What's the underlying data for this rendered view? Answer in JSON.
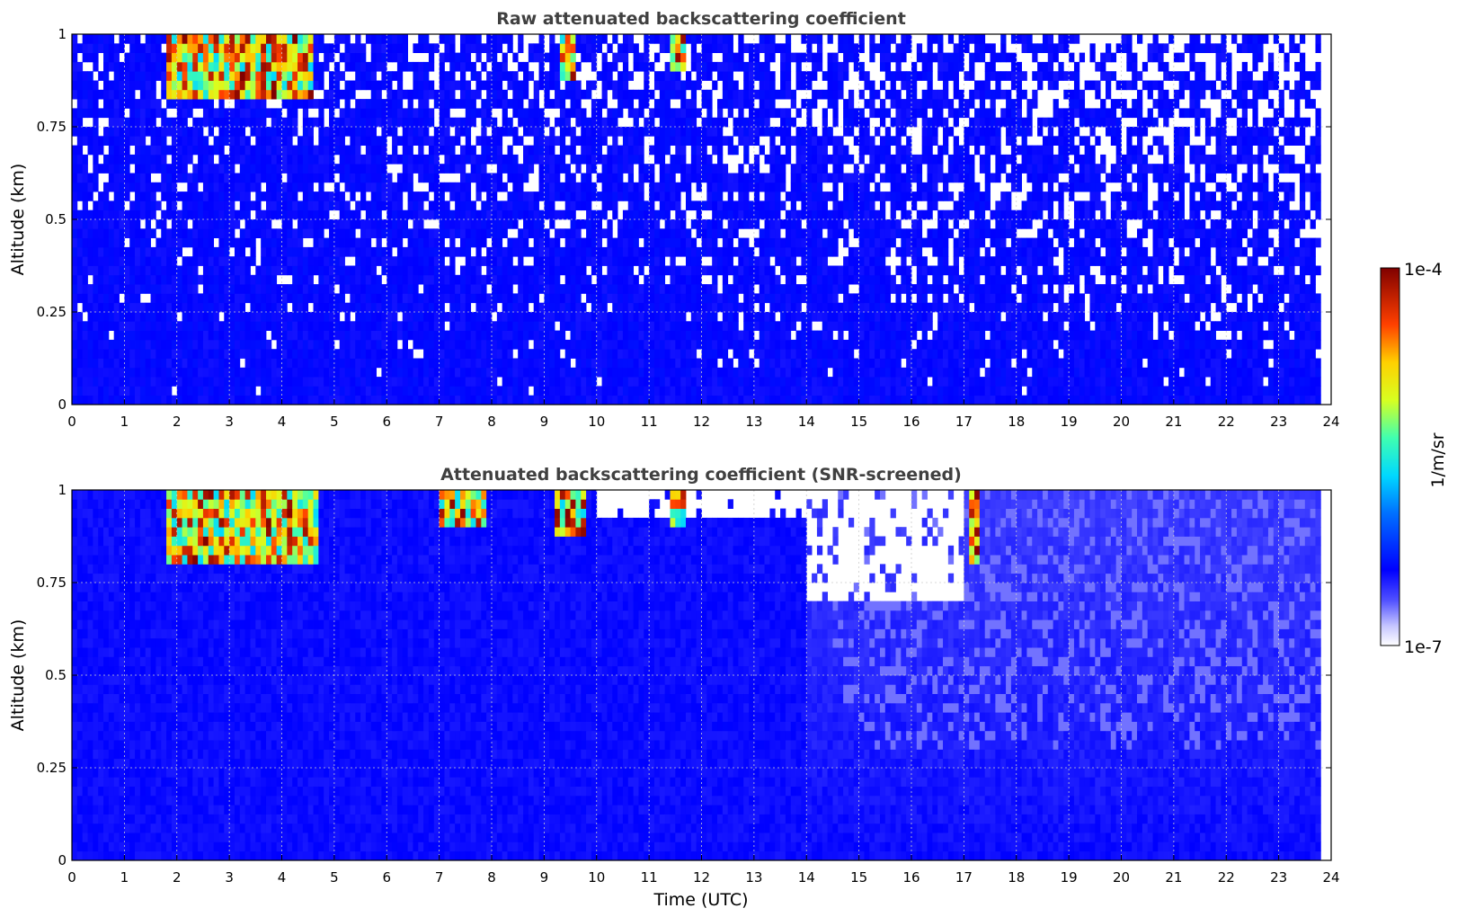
{
  "chart_data": [
    {
      "type": "heatmap",
      "title": "Raw attenuated backscattering coefficient",
      "xlabel": "",
      "ylabel": "Altitude (km)",
      "xlim": [
        0,
        24
      ],
      "ylim": [
        0,
        1
      ],
      "x_ticks": [
        "0",
        "1",
        "2",
        "3",
        "4",
        "5",
        "6",
        "7",
        "8",
        "9",
        "10",
        "11",
        "12",
        "13",
        "14",
        "15",
        "16",
        "17",
        "18",
        "19",
        "20",
        "21",
        "22",
        "23",
        "24"
      ],
      "y_ticks": [
        "0",
        "0.25",
        "0.5",
        "0.75",
        "1"
      ],
      "grid": true,
      "cloud_events_utc": [
        {
          "start": 1.8,
          "end": 4.6,
          "base_km": 0.82
        },
        {
          "start": 9.3,
          "end": 9.6,
          "base_km": 0.88
        },
        {
          "start": 11.45,
          "end": 11.7,
          "base_km": 0.9
        }
      ]
    },
    {
      "type": "heatmap",
      "title": "Attenuated backscattering coefficient (SNR-screened)",
      "xlabel": "Time (UTC)",
      "ylabel": "Altitude (km)",
      "xlim": [
        0,
        24
      ],
      "ylim": [
        0,
        1
      ],
      "x_ticks": [
        "0",
        "1",
        "2",
        "3",
        "4",
        "5",
        "6",
        "7",
        "8",
        "9",
        "10",
        "11",
        "12",
        "13",
        "14",
        "15",
        "16",
        "17",
        "18",
        "19",
        "20",
        "21",
        "22",
        "23",
        "24"
      ],
      "y_ticks": [
        "0",
        "0.25",
        "0.5",
        "0.75",
        "1"
      ],
      "grid": true,
      "cloud_events_utc": [
        {
          "start": 1.8,
          "end": 4.7,
          "base_km": 0.8
        },
        {
          "start": 7.0,
          "end": 7.9,
          "base_km": 0.9
        },
        {
          "start": 9.2,
          "end": 9.8,
          "base_km": 0.88
        },
        {
          "start": 11.45,
          "end": 11.7,
          "base_km": 0.9
        },
        {
          "start": 17.1,
          "end": 17.3,
          "base_km": 0.8
        }
      ]
    }
  ],
  "colorbar": {
    "label": "1/m/sr",
    "max_label": "1e-4",
    "min_label": "1e-7",
    "scale": "log",
    "colormap": "jet"
  },
  "colors": {
    "text": "#000000",
    "title": "#404040",
    "grid": "#cccccc",
    "background": "#ffffff"
  }
}
